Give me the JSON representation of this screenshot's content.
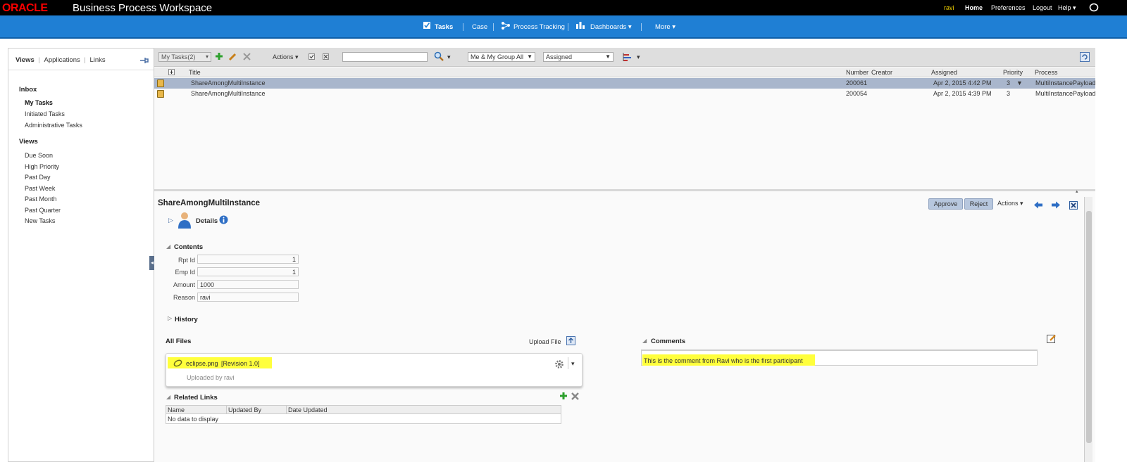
{
  "header": {
    "brand": "ORACLE",
    "app_title": "Business Process Workspace",
    "user": "ravi",
    "links": [
      "Home",
      "Preferences",
      "Logout",
      "Help ▾"
    ]
  },
  "nav": {
    "tasks": "Tasks",
    "case": "Case",
    "process_tracking": "Process Tracking",
    "dashboards": "Dashboards ▾",
    "more": "More ▾"
  },
  "left": {
    "tabs": [
      "Views",
      "Applications",
      "Links"
    ],
    "inbox_title": "Inbox",
    "inbox_items": [
      "My Tasks",
      "Initiated Tasks",
      "Administrative Tasks"
    ],
    "views_title": "Views",
    "view_items": [
      "Due Soon",
      "High Priority",
      "Past Day",
      "Past Week",
      "Past Month",
      "Past Quarter",
      "New Tasks"
    ]
  },
  "toolbar": {
    "view_select": "My Tasks(2)",
    "actions": "Actions ▾",
    "search_value": "",
    "assignee_filter": "Me & My Group All",
    "state_filter": "Assigned"
  },
  "grid": {
    "columns": {
      "title": "Title",
      "number": "Number",
      "creator": "Creator",
      "assigned": "Assigned",
      "priority": "Priority",
      "process": "Process"
    },
    "rows": [
      {
        "title": "ShareAmongMultiInstance",
        "number": "200061",
        "creator": "",
        "assigned": "Apr 2, 2015 4:42 PM",
        "priority": "3",
        "process": "MultiInstancePayload"
      },
      {
        "title": "ShareAmongMultiInstance",
        "number": "200054",
        "creator": "",
        "assigned": "Apr 2, 2015 4:39 PM",
        "priority": "3",
        "process": "MultiInstancePayload"
      }
    ]
  },
  "detail": {
    "title": "ShareAmongMultiInstance",
    "approve": "Approve",
    "reject": "Reject",
    "actions": "Actions ▾",
    "details_label": "Details",
    "contents_title": "Contents",
    "fields": [
      {
        "label": "Rpt Id",
        "value": "1"
      },
      {
        "label": "Emp Id",
        "value": "1"
      },
      {
        "label": "Amount",
        "value": "1000"
      },
      {
        "label": "Reason",
        "value": "ravi"
      }
    ],
    "history_title": "History",
    "all_files_title": "All Files",
    "upload_file": "Upload File",
    "file_name": "eclipse.png",
    "file_revision": "[Revision 1.0]",
    "uploaded_by": "Uploaded by ravi",
    "related_links_title": "Related Links",
    "related_columns": [
      "Name",
      "Updated By",
      "Date Updated"
    ],
    "no_data": "No data to display",
    "comments_title": "Comments",
    "comment_text": "This is the comment from Ravi who is the first participant"
  },
  "colors": {
    "nav_blue": "#1f7fd4",
    "selected_row": "#a9b6cc",
    "highlight": "#ffff3c",
    "oracle_red": "#f80000"
  }
}
